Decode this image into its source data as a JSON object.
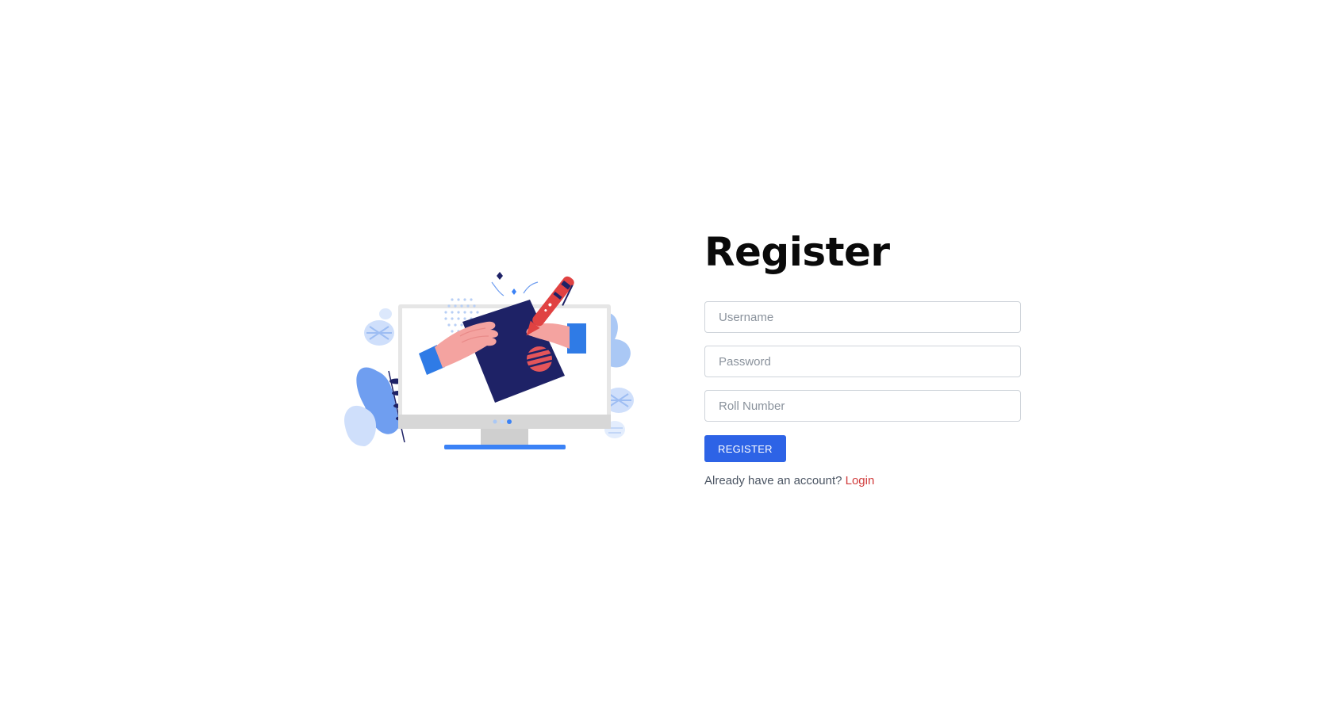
{
  "form": {
    "title": "Register",
    "username_placeholder": "Username",
    "password_placeholder": "Password",
    "roll_placeholder": "Roll Number",
    "submit_label": "REGISTER",
    "footer_text": "Already have an account?",
    "login_label": "Login"
  },
  "colors": {
    "primary_button": "#2d63e6",
    "login_link": "#d03a3a",
    "illustration_navy": "#1e2266",
    "illustration_blue": "#3b82f6",
    "illustration_light_blue": "#aac8f5"
  },
  "illustration": {
    "icon": "register-illustration-icon"
  }
}
